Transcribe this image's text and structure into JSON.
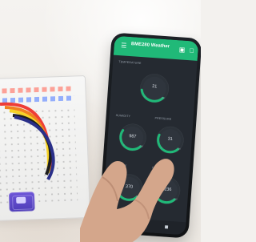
{
  "app": {
    "title": "BME280 Weather"
  },
  "icons": {
    "menu": "menu-icon",
    "action_one": "screen-share-icon",
    "action_two": "square-icon",
    "nav_back": "back-icon",
    "nav_home": "home-icon",
    "nav_recent": "recent-apps-icon"
  },
  "gauges": [
    {
      "label": "TEMPERATURE",
      "value": "21",
      "min": "0",
      "max": "100",
      "level": 0.46
    },
    {
      "label": "HUMIDITY",
      "value": "987",
      "min": "0",
      "max": "100",
      "level": 0.62
    },
    {
      "label": "PRESSURE",
      "value": "31",
      "min": "0",
      "max": "100",
      "level": 0.58
    },
    {
      "label": "ALTITUDE",
      "value": "370",
      "min": "0",
      "max": "100",
      "level": 0.48
    },
    {
      "label": "DEWPOINT",
      "value": "2236",
      "min": "0",
      "max": "100",
      "level": 0.76
    }
  ],
  "colors": {
    "accent": "#20b978",
    "screen": "#252a31",
    "board_blue": "#5a48cc",
    "hand": "#d4a68b"
  }
}
